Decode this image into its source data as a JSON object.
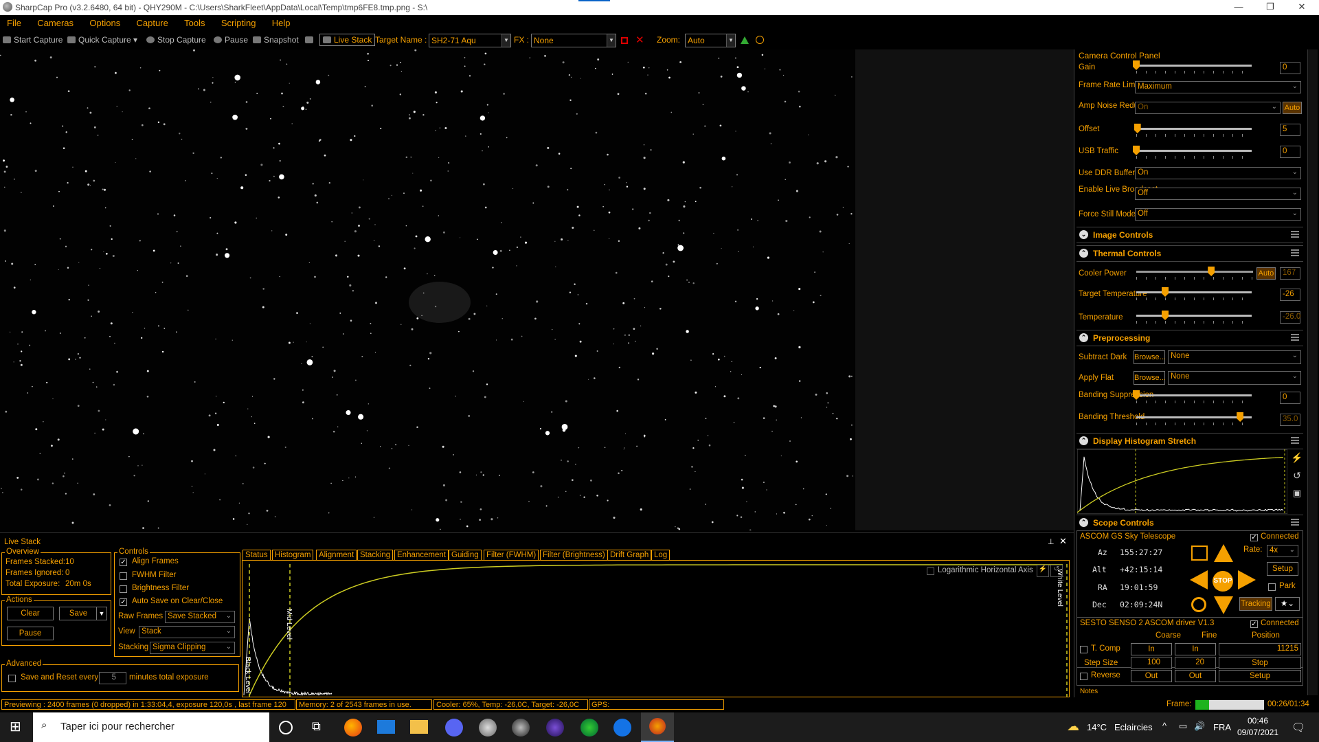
{
  "window": {
    "title": "SharpCap Pro (v3.2.6480, 64 bit) - QHY290M - C:\\Users\\SharkFleet\\AppData\\Local\\Temp\\tmp6FE8.tmp.png - S:\\",
    "minimize": "—",
    "maximize": "❐",
    "close": "✕"
  },
  "menu": [
    "File",
    "Cameras",
    "Options",
    "Capture",
    "Tools",
    "Scripting",
    "Help"
  ],
  "toolbar": {
    "start_capture": "Start Capture",
    "quick_capture": "Quick Capture",
    "stop_capture": "Stop Capture",
    "pause": "Pause",
    "snapshot": "Snapshot",
    "live_stack": "Live Stack",
    "target_name_label": "Target Name :",
    "target_name_value": "SH2-71 Aqu",
    "fx_label": "FX :",
    "fx_value": "None",
    "zoom_label": "Zoom:",
    "zoom_value": "Auto"
  },
  "camera_panel": {
    "title": "Camera Control Panel",
    "gain": {
      "label": "Gain",
      "value": "0",
      "level": 0
    },
    "frame_rate_limit": {
      "label": "Frame Rate Limit",
      "value": "Maximum"
    },
    "amp_noise": {
      "label": "Amp Noise Reduction",
      "value": "On",
      "auto": "Auto"
    },
    "offset": {
      "label": "Offset",
      "value": "5",
      "level": 0.01
    },
    "usb_traffic": {
      "label": "USB Traffic",
      "value": "0",
      "level": 0
    },
    "use_ddr": {
      "label": "Use DDR Buffer",
      "value": "On"
    },
    "enable_live_broadcast": {
      "label": "Enable Live Broadcast",
      "value": "Off"
    },
    "force_still": {
      "label": "Force Still Mode",
      "value": "Off"
    },
    "image_controls": "Image Controls",
    "thermal_controls": "Thermal Controls",
    "cooler_power": {
      "label": "Cooler Power",
      "auto": "Auto",
      "value": "167",
      "level": 0.65
    },
    "target_temperature": {
      "label": "Target Temperature",
      "value": "-26",
      "level": 0.25
    },
    "temperature": {
      "label": "Temperature",
      "value": "-26.0",
      "level": 0.25
    },
    "preprocessing": "Preprocessing",
    "subtract_dark": {
      "label": "Subtract Dark",
      "browse": "Browse...",
      "value": "None"
    },
    "apply_flat": {
      "label": "Apply Flat",
      "browse": "Browse...",
      "value": "None"
    },
    "banding_suppression": {
      "label": "Banding Suppression",
      "value": "0",
      "level": 0
    },
    "banding_threshold": {
      "label": "Banding Threshold",
      "value": "35.0",
      "level": 0.9
    },
    "display_histogram": "Display Histogram Stretch",
    "scope_controls": "Scope Controls",
    "telescope": {
      "name": "ASCOM GS Sky Telescope",
      "connected": "Connected",
      "az_label": "Az",
      "az": "155:27:27",
      "alt_label": "Alt",
      "alt": "+42:15:14",
      "ra_label": "RA",
      "ra": "19:01:59",
      "dec_label": "Dec",
      "dec": "02:09:24N",
      "rate_label": "Rate:",
      "rate": "4x",
      "setup": "Setup",
      "park": "Park",
      "stop": "STOP",
      "tracking": "Tracking"
    },
    "focuser": {
      "name": "SESTO SENSO 2 ASCOM driver V1.3",
      "connected": "Connected",
      "coarse": "Coarse",
      "fine": "Fine",
      "position": "Position",
      "tcomp": "T. Comp",
      "in": "In",
      "position_value": "11215",
      "step_size": "Step Size",
      "coarse_step": "100",
      "fine_step": "20",
      "stop": "Stop",
      "reverse": "Reverse",
      "out": "Out",
      "setup": "Setup"
    },
    "notes": "Notes"
  },
  "live_stack": {
    "title": "Live Stack",
    "overview": "Overview",
    "frames_stacked_label": "Frames Stacked:",
    "frames_stacked": "10",
    "frames_ignored_label": "Frames Ignored:",
    "frames_ignored": "0",
    "total_exposure_label": "Total Exposure:",
    "total_exposure": "20m 0s",
    "actions": "Actions",
    "clear": "Clear",
    "save": "Save",
    "pause": "Pause",
    "advanced": "Advanced",
    "save_reset": "Save and Reset every",
    "save_reset_value": "5",
    "minutes": "minutes total exposure",
    "controls": "Controls",
    "align_frames": "Align Frames",
    "fwhm_filter": "FWHM Filter",
    "brightness_filter": "Brightness Filter",
    "auto_save": "Auto Save on Clear/Close",
    "raw_frames_label": "Raw Frames",
    "raw_frames": "Save Stacked",
    "view_label": "View",
    "view": "Stack",
    "stacking_label": "Stacking",
    "stacking": "Sigma Clipping",
    "tabs": [
      "Status",
      "Histogram",
      "Alignment",
      "Stacking",
      "Enhancement",
      "Guiding",
      "Filter (FWHM)",
      "Filter (Brightness)",
      "Drift Graph",
      "Log"
    ],
    "log_axis": "Logarithmic Horizontal Axis",
    "black_level": "Black Level",
    "mid_level": "Mid Level",
    "white_level": "White Level"
  },
  "status": {
    "previewing": "Previewing : 2400 frames (0 dropped) in 1:33:04,4, exposure 120,0s , last frame 120",
    "memory": "Memory: 2 of 2543 frames in use.",
    "cooler": "Cooler: 65%, Temp: -26,0C, Target: -26,0C",
    "gps": "GPS:",
    "frame_label": "Frame:",
    "frame_progress": 0.2,
    "frame_time": "00:26/01:34"
  },
  "taskbar": {
    "search": "Taper ici pour rechercher",
    "weather_temp": "14°C",
    "weather_text": "Eclaircies",
    "lang": "FRA",
    "time": "00:46",
    "date": "09/07/2021"
  }
}
